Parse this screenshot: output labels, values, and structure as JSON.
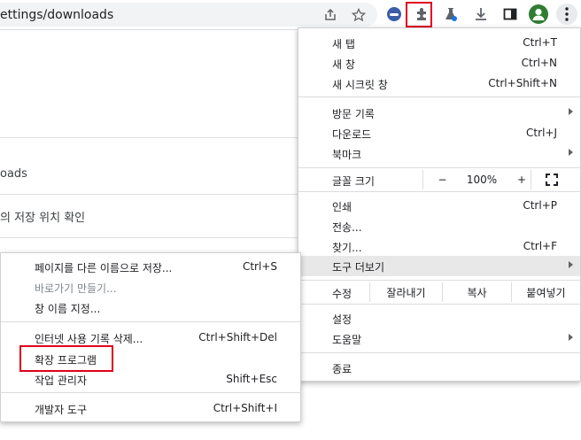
{
  "toolbar": {
    "url_text": "ettings/downloads",
    "share_icon": "share-icon",
    "star_icon": "bookmark-star-icon",
    "extensions_icon": "puzzle-piece-icon",
    "labs_icon": "flask-icon",
    "download_icon": "download-icon",
    "sidepanel_icon": "side-panel-icon",
    "profile_icon": "avatar",
    "menu_icon": "three-dot-menu-icon"
  },
  "page": {
    "line1": "oads",
    "line2": "의 저장 위치 확인"
  },
  "main_menu": {
    "group1": [
      {
        "label": "새 탭",
        "shortcut": "Ctrl+T"
      },
      {
        "label": "새 창",
        "shortcut": "Ctrl+N"
      },
      {
        "label": "새 시크릿 창",
        "shortcut": "Ctrl+Shift+N"
      }
    ],
    "group2": [
      {
        "label": "방문 기록",
        "shortcut": ""
      },
      {
        "label": "다운로드",
        "shortcut": "Ctrl+J"
      },
      {
        "label": "북마크",
        "shortcut": ""
      }
    ],
    "zoom": {
      "label": "글꼴 크기",
      "minus": "−",
      "value": "100%",
      "plus": "+"
    },
    "group3": [
      {
        "label": "인쇄",
        "shortcut": "Ctrl+P"
      },
      {
        "label": "전송...",
        "shortcut": ""
      },
      {
        "label": "찾기...",
        "shortcut": "Ctrl+F"
      },
      {
        "label": "도구 더보기",
        "shortcut": ""
      }
    ],
    "edit": {
      "label": "수정",
      "cut": "잘라내기",
      "copy": "복사",
      "paste": "붙여넣기"
    },
    "group4": [
      {
        "label": "설정",
        "shortcut": ""
      },
      {
        "label": "도움말",
        "shortcut": ""
      }
    ],
    "exit": {
      "label": "종료"
    }
  },
  "sub_menu": {
    "group1": [
      {
        "label": "페이지를 다른 이름으로 저장...",
        "shortcut": "Ctrl+S"
      },
      {
        "label": "바로가기 만들기...",
        "shortcut": ""
      },
      {
        "label": "창 이름 지정...",
        "shortcut": ""
      }
    ],
    "group2": [
      {
        "label": "인터넷 사용 기록 삭제...",
        "shortcut": "Ctrl+Shift+Del"
      },
      {
        "label": "확장 프로그램",
        "shortcut": ""
      },
      {
        "label": "작업 관리자",
        "shortcut": "Shift+Esc"
      }
    ],
    "group3": [
      {
        "label": "개발자 도구",
        "shortcut": "Ctrl+Shift+I"
      }
    ]
  },
  "colors": {
    "highlight_box": "#e0001b",
    "menu_hover": "#e8e8e8"
  }
}
